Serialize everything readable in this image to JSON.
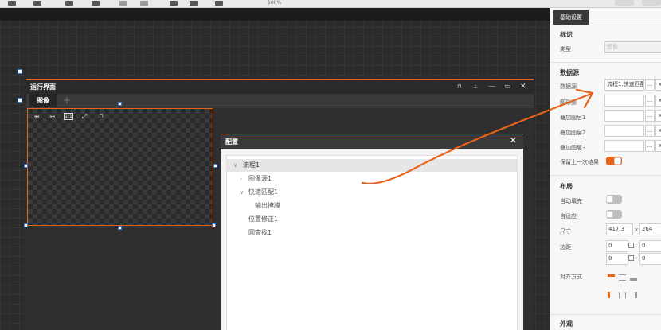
{
  "colors": {
    "accent": "#e8641b",
    "canvas_bg": "#2b2b2b",
    "panel_bg": "#f7f7f7"
  },
  "toolbar": {
    "zoom_label": "100%",
    "btn1_label": "",
    "btn2_label": ""
  },
  "run_window": {
    "title": "运行界面",
    "tab_label": "图像",
    "tab_add": "+",
    "controls": {
      "lock": "lock-icon",
      "pin": "pin-icon",
      "minimize": "—",
      "restore": "▭",
      "close": "✕"
    },
    "image_tools": [
      "zoom-in-icon",
      "zoom-out-icon",
      "actual-size-icon",
      "fit-icon",
      "lock-icon"
    ],
    "image_tool_glyphs": [
      "⊕",
      "⊖",
      "1:1",
      "⤢",
      "🔒"
    ]
  },
  "config": {
    "title": "配置",
    "close": "✕",
    "tree": [
      {
        "label": "流程1",
        "level": 0,
        "expanded": true,
        "selected": true
      },
      {
        "label": "图像源1",
        "level": 1,
        "expanded": false
      },
      {
        "label": "快速匹配1",
        "level": 1,
        "expanded": true
      },
      {
        "label": "输出掩膜",
        "level": 2
      },
      {
        "label": "位置修正1",
        "level": 1
      },
      {
        "label": "圆查找1",
        "level": 1
      }
    ]
  },
  "props": {
    "tab": "基础设置",
    "identity": {
      "title": "标识",
      "type_label": "类型",
      "type_value": "图像"
    },
    "datasource": {
      "title": "数据源",
      "source_label": "数据源",
      "source_value": "流程1.快速匹配",
      "image_source_label": "图形源",
      "overlay1_label": "叠加图层1",
      "overlay2_label": "叠加图层2",
      "overlay3_label": "叠加图层3",
      "keep_last_label": "保留上一次结果",
      "keep_last_on": true,
      "more_btn": "...",
      "clear_btn": "x"
    },
    "layout": {
      "title": "布局",
      "auto_fill_label": "自动填充",
      "auto_fill_on": false,
      "adaptive_label": "自适应",
      "adaptive_on": false,
      "size_label": "尺寸",
      "width": "417.3",
      "height": "264",
      "x_sep": "x",
      "margin_label": "边距",
      "margins": [
        "0",
        "0",
        "0",
        "0"
      ],
      "align_label": "对齐方式"
    },
    "appearance": {
      "title": "外观"
    }
  }
}
